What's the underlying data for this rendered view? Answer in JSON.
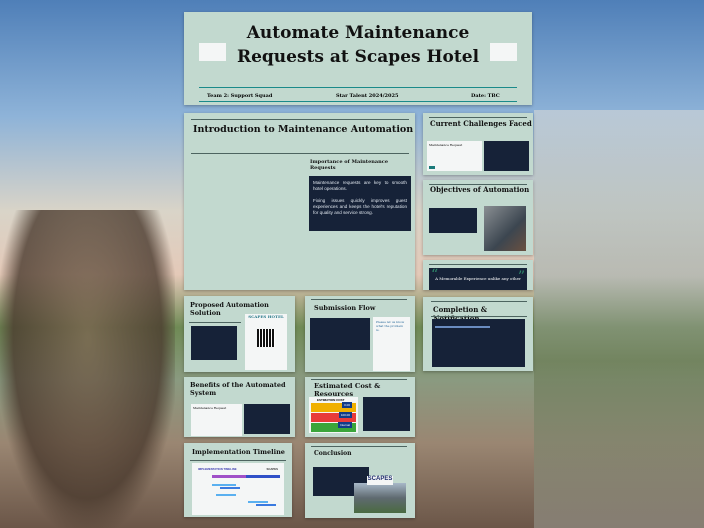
{
  "title": {
    "line1": "Automate Maintenance",
    "line2": "Requests at Scapes Hotel",
    "team": "Team 2: Support Squad",
    "program": "Star Talent 2024/2025",
    "date": "Date: TBC"
  },
  "intro": {
    "heading": "Introduction to Maintenance Automation",
    "subheading": "Importance of Maintenance Requests",
    "p1": "Maintenance requests are key to smooth hotel operations.",
    "p2": "Fixing issues quickly improves guest experiences and keeps the hotel's reputation for quality and service strong."
  },
  "challenges": {
    "heading": "Current Challenges Faced",
    "form_title": "Maintenance Request"
  },
  "objectives": {
    "heading": "Objectives of Automation"
  },
  "quote": {
    "text": "A Memorable Experience unlike any other"
  },
  "completion": {
    "heading": "Completion & Notification"
  },
  "proposed": {
    "heading": "Proposed Automation Solution",
    "poster_title": "SCAPES HOTEL"
  },
  "submission": {
    "heading": "Submission Flow",
    "form_title": "Please let us know what the problem is."
  },
  "benefits": {
    "heading": "Benefits of the Automated System",
    "form_title": "Maintenance Request"
  },
  "cost": {
    "heading": "Estimated Cost & Resources",
    "table_title": "ESTIMATION COST",
    "values": [
      "0.00",
      "100.00",
      "Internal"
    ]
  },
  "timeline": {
    "heading": "Implementation Timeline",
    "chart_title": "IMPLEMENTATION TIMELINE",
    "brand": "SCAPES"
  },
  "conclusion": {
    "heading": "Conclusion",
    "brand": "SCAPES"
  }
}
